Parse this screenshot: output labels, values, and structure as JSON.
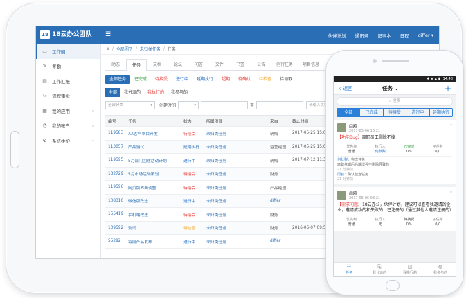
{
  "header": {
    "logo_mark": "18",
    "brand": "18云办公团队",
    "menu_glyph": "☰",
    "nav": [
      "伙伴计划",
      "通讯录",
      "记事本",
      "日程",
      "differ ▾"
    ]
  },
  "sidebar": {
    "items": [
      {
        "icon": "▭",
        "label": "工作圈",
        "chev": ""
      },
      {
        "icon": "✎",
        "label": "考勤",
        "chev": ""
      },
      {
        "icon": "▤",
        "label": "工作汇报",
        "chev": ""
      },
      {
        "icon": "⚇",
        "label": "流程审批",
        "chev": ""
      },
      {
        "icon": "▦",
        "label": "我的应用",
        "chev": "⌄"
      },
      {
        "icon": "◔",
        "label": "我的账户",
        "chev": "⌄"
      },
      {
        "icon": "⚙",
        "label": "系统维护",
        "chev": "⌄"
      }
    ]
  },
  "breadcrumb": {
    "home_glyph": "⌂",
    "items": [
      "全局圈子",
      "未归类任务",
      "任务"
    ]
  },
  "tabs": [
    "动态",
    "任务",
    "文档",
    "论坛",
    "问答",
    "文件",
    "书签",
    "公告",
    "例行任务",
    "项目信息"
  ],
  "status_filters": [
    "全部任务",
    "已完成",
    "待接受",
    "进行中",
    "延期执行",
    "超期",
    "待确认",
    "待检查",
    "待领取"
  ],
  "sub_filters": [
    "全部",
    "我分派的",
    "我执行的",
    "我参与的"
  ],
  "filters": {
    "category": "全部分类",
    "creator_label": "创建时间",
    "to_label": "至",
    "keyword_placeholder": "请输入关键字"
  },
  "table": {
    "headers": [
      "编号",
      "任务",
      "状态",
      "所属项目",
      "来自",
      "截止时间"
    ],
    "rows": [
      [
        "119583",
        "XX客户项目开发",
        "待接受",
        "未归类任务",
        "萌梅",
        "2017-05-25 15:0"
      ],
      [
        "113057",
        "产品测试",
        "延期执行",
        "未归类任务",
        "运营经理",
        "2017-05-25 15:0"
      ],
      [
        "119595",
        "5月部门团建活动计划",
        "进行中",
        "未归类任务",
        "萌梅",
        "2017-07-12 11:3"
      ],
      [
        "132729",
        "5月市场活动策划",
        "待接受",
        "未归类任务",
        "财务",
        ""
      ],
      [
        "119596",
        "网页版界面调整",
        "待接受",
        "未归类任务",
        "产品经理",
        ""
      ],
      [
        "108310",
        "微信版改进",
        "进行中",
        "未归类任务",
        "differ",
        ""
      ],
      [
        "155419",
        "手机端改进",
        "待接受",
        "未归类任务",
        "财务",
        ""
      ],
      [
        "109592",
        "测试",
        "待检查",
        "未归类任务",
        "财务",
        "2016-06-07 09:5"
      ],
      [
        "55292",
        "每周产品发布",
        "进行中",
        "未归类任务",
        "differ",
        ""
      ]
    ]
  },
  "phone": {
    "status_time": "14:48",
    "status_icons": "✱ ◈ ▲ ▮",
    "back": "〈 返回",
    "title": "任务 ⌄",
    "plus": "+",
    "search": "⌕ 搜索",
    "tabs": [
      "全部",
      "已完成",
      "待接受",
      "进行中",
      "延期执行"
    ],
    "cards": [
      {
        "name": "闫鸥",
        "time": "2017-05-06 10:21",
        "tag": "【功能Bug】",
        "title": "离职员工删除不掉",
        "cells": [
          [
            "优先级",
            "普通"
          ],
          [
            "执行人",
            "何秋梨"
          ],
          [
            "已完成",
            "0%"
          ],
          [
            "子任务",
            "0/0"
          ]
        ],
        "comments": [
          {
            "who": "何秋梨：",
            "text": "完成任务"
          },
          {
            "who": "",
            "text": "离职依期后后端增强不删除导致的"
          },
          {
            "who": "",
            "text": "21 分钟前"
          },
          {
            "who": "闫鸥：",
            "text": "确认检查任务"
          },
          {
            "who": "",
            "text": "21 分钟前"
          }
        ]
      },
      {
        "name": "闫鸥",
        "time": "2017-05-06 08:21",
        "tag": "【需求问题】",
        "title": "18云办公，伙伴计划，建议可以查看我邀请的企业，邀请成功的和失败的，已注册的（通过其他人邀请注册的）",
        "cells": [
          [
            "优先级",
            "普通"
          ],
          [
            "执行人",
            "无"
          ],
          [
            "待接受",
            "0%"
          ],
          [
            "子任务",
            "0/0"
          ]
        ],
        "comments": []
      }
    ],
    "bottom": [
      {
        "icon": "☷",
        "label": "任务"
      },
      {
        "icon": "⎘",
        "label": "我分派的"
      },
      {
        "icon": "◫",
        "label": "我执行的"
      },
      {
        "icon": "◍",
        "label": "我参与的"
      }
    ]
  }
}
